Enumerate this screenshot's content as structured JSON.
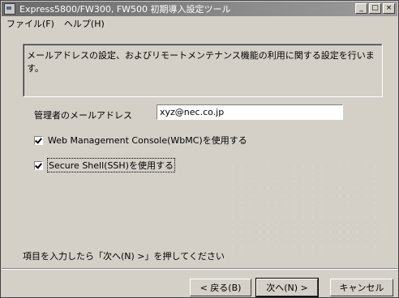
{
  "window": {
    "title": "Express5800/FW300, FW500 初期導入設定ツール",
    "caption_buttons": {
      "minimize": "_",
      "maximize": "□",
      "close": "×"
    }
  },
  "menu": {
    "file": "ファイル(F)",
    "help": "ヘルプ(H)"
  },
  "description": "メールアドレスの設定、およびリモートメンテナンス機能の利用に関する設定を行います。",
  "form": {
    "admin_email_label": "管理者のメールアドレス",
    "admin_email_value": "xyz@nec.co.jp",
    "wbmc_label": "Web Management Console(WbMC)を使用する",
    "wbmc_checked": true,
    "ssh_label": "Secure Shell(SSH)を使用する",
    "ssh_checked": true
  },
  "instruction": "項目を入力したら「次へ(N) >」を押してください",
  "buttons": {
    "back": "< 戻る(B)",
    "next": "次へ(N) >",
    "cancel": "キャンセル"
  }
}
